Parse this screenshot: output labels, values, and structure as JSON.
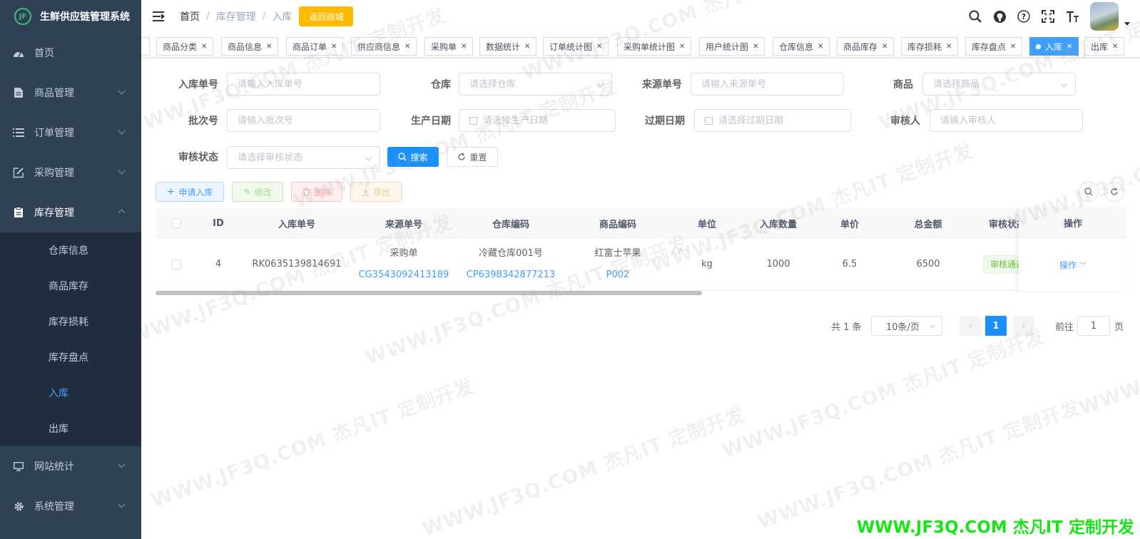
{
  "app": {
    "title": "生鲜供应链管理系统",
    "logo_text": "JF"
  },
  "sidebar": {
    "items": [
      {
        "label": "首页",
        "icon": "dashboard-icon"
      },
      {
        "label": "商品管理",
        "icon": "document-icon"
      },
      {
        "label": "订单管理",
        "icon": "list-icon"
      },
      {
        "label": "采购管理",
        "icon": "edit-icon"
      },
      {
        "label": "库存管理",
        "icon": "clipboard-icon"
      }
    ],
    "sub_items": [
      {
        "label": "仓库信息"
      },
      {
        "label": "商品库存"
      },
      {
        "label": "库存损耗"
      },
      {
        "label": "库存盘点"
      },
      {
        "label": "入库",
        "active": true
      },
      {
        "label": "出库"
      }
    ],
    "bottom_items": [
      {
        "label": "网站统计",
        "icon": "monitor-icon"
      },
      {
        "label": "系统管理",
        "icon": "gear-icon"
      }
    ]
  },
  "header": {
    "breadcrumb": [
      "首页",
      "库存管理",
      "入库"
    ],
    "back_button": "返回商城",
    "icons": [
      "search-icon",
      "github-icon",
      "help-icon",
      "fullscreen-icon",
      "font-size-icon"
    ]
  },
  "tags": [
    {
      "label": ""
    },
    {
      "label": "商品分类"
    },
    {
      "label": "商品信息"
    },
    {
      "label": "商品订单"
    },
    {
      "label": "供应商信息"
    },
    {
      "label": "采购单"
    },
    {
      "label": "数据统计"
    },
    {
      "label": "订单统计图"
    },
    {
      "label": "采购单统计图"
    },
    {
      "label": "用户统计图"
    },
    {
      "label": "仓库信息"
    },
    {
      "label": "商品库存"
    },
    {
      "label": "库存损耗"
    },
    {
      "label": "库存盘点"
    },
    {
      "label": "入库",
      "active": true
    },
    {
      "label": "出库"
    }
  ],
  "form": {
    "order_no": {
      "label": "入库单号",
      "placeholder": "请输入入库单号"
    },
    "warehouse": {
      "label": "仓库",
      "placeholder": "请选择仓库"
    },
    "source_no": {
      "label": "来源单号",
      "placeholder": "请输入来源单号"
    },
    "product": {
      "label": "商品",
      "placeholder": "请选择商品"
    },
    "batch_no": {
      "label": "批次号",
      "placeholder": "请输入批次号"
    },
    "produce_date": {
      "label": "生产日期",
      "placeholder": "请选择生产日期"
    },
    "expire_date": {
      "label": "过期日期",
      "placeholder": "请选择过期日期"
    },
    "auditor": {
      "label": "审核人",
      "placeholder": "请输入审核人"
    },
    "audit_status": {
      "label": "审核状态",
      "placeholder": "请选择审核状态"
    },
    "search_button": "搜索",
    "reset_button": "重置"
  },
  "toolbar": {
    "apply": "申请入库",
    "edit": "修改",
    "delete": "删除",
    "export": "导出"
  },
  "table": {
    "columns": [
      "ID",
      "入库单号",
      "来源单号",
      "仓库编码",
      "商品编码",
      "单位",
      "入库数量",
      "单价",
      "总金额",
      "审核状态",
      "操作"
    ],
    "rows": [
      {
        "id": "4",
        "order_no": "RK0635139814691",
        "source_type": "采购单",
        "source_no": "CG3543092413189",
        "warehouse_name": "冷藏仓库001号",
        "warehouse_code": "CP6398342877213",
        "product_name": "红富士苹果",
        "product_code": "P002",
        "unit": "kg",
        "quantity": "1000",
        "price": "6.5",
        "total": "6500",
        "status": "审核通过",
        "action": "操作"
      }
    ]
  },
  "pagination": {
    "total": "共 1 条",
    "page_size": "10条/页",
    "current": "1",
    "goto_label": "前往",
    "goto_value": "1",
    "page_suffix": "页"
  },
  "watermark": {
    "text": "WWW.JF3Q.COM 杰凡IT  定制开发",
    "footer": "WWW.JF3Q.COM 杰凡IT  定制开发",
    "footer_color": "#18e418"
  },
  "colors": {
    "sidebar_bg": "#304156",
    "sidebar_sub_bg": "#1f2d3d",
    "primary": "#1890ff",
    "warning": "#ffba00",
    "success": "#67c23a"
  }
}
